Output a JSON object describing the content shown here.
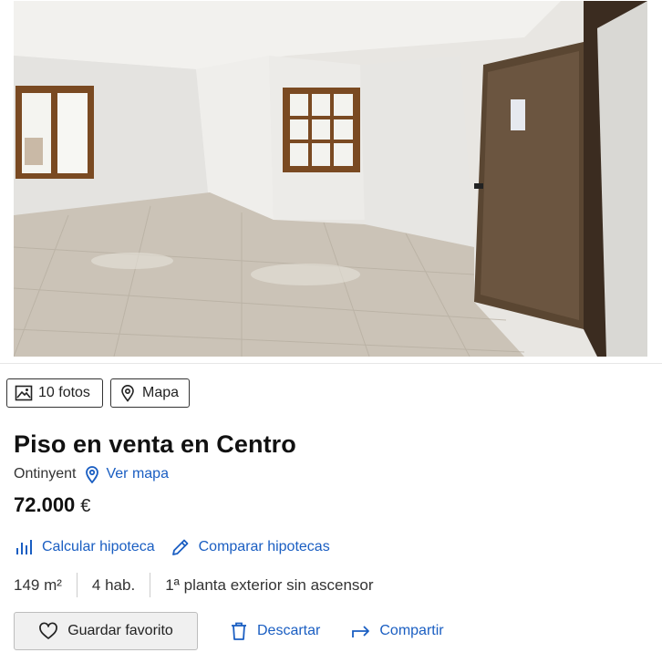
{
  "photo": {
    "alt_icon": "room-photo"
  },
  "chips": {
    "photos_label": "10 fotos",
    "map_label": "Mapa"
  },
  "listing": {
    "title": "Piso en venta en Centro",
    "location": "Ontinyent",
    "map_link": "Ver mapa",
    "price": "72.000",
    "currency": "€"
  },
  "mortgage": {
    "calculate_label": "Calcular hipoteca",
    "compare_label": "Comparar hipotecas"
  },
  "features": [
    "149 m²",
    "4 hab.",
    "1ª planta exterior sin ascensor"
  ],
  "actions": {
    "favorite_label": "Guardar favorito",
    "discard_label": "Descartar",
    "share_label": "Compartir"
  },
  "colors": {
    "link": "#1a5ec2",
    "text": "#222222",
    "button_bg": "#f0f0f0"
  }
}
